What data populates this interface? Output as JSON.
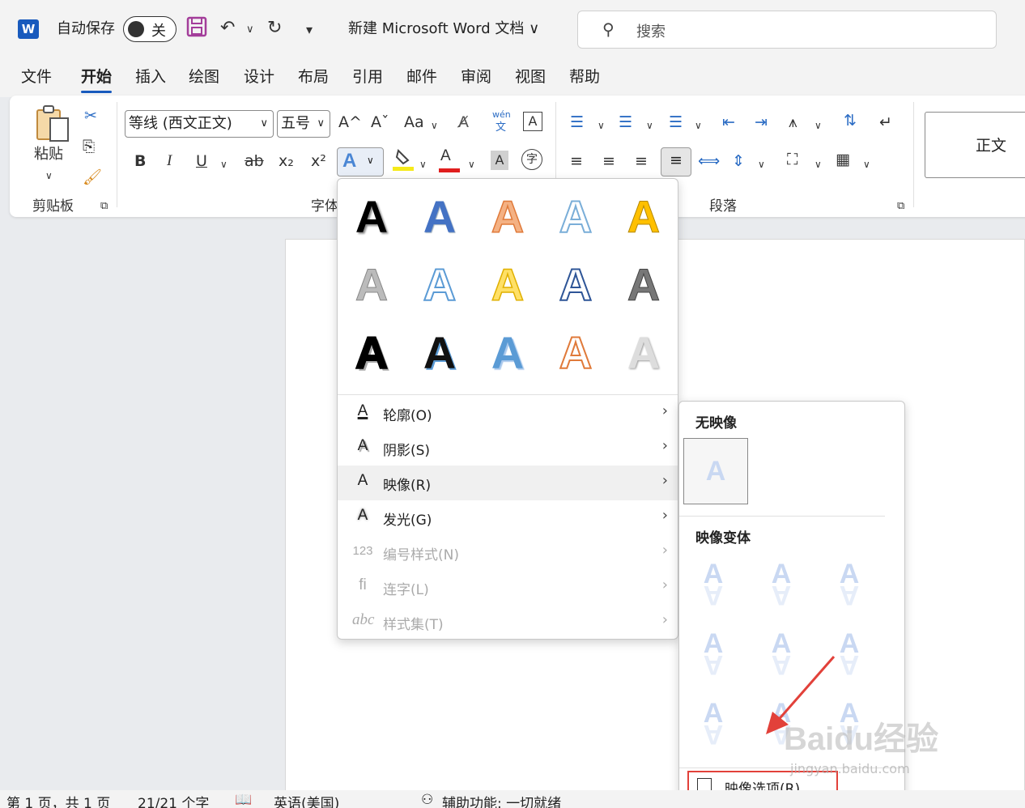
{
  "titlebar": {
    "logo": "W",
    "autosave_label": "自动保存",
    "autosave_state": "关",
    "doc_title": "新建 Microsoft Word 文档 ∨",
    "search_placeholder": "搜索"
  },
  "tabs": [
    "文件",
    "开始",
    "插入",
    "绘图",
    "设计",
    "布局",
    "引用",
    "邮件",
    "审阅",
    "视图",
    "帮助"
  ],
  "active_tab": "开始",
  "ribbon": {
    "paste_label": "粘贴",
    "clipboard_group": "剪贴板",
    "font_group": "字体",
    "paragraph_group": "段落",
    "font_name": "等线 (西文正文)",
    "font_size": "五号",
    "style_normal": "正文",
    "buttons": {
      "bold": "B",
      "italic": "I",
      "underline": "U",
      "strike": "ab",
      "sub": "x₂",
      "sup": "x²",
      "grow": "A^",
      "shrink": "Aˇ",
      "case": "Aa",
      "phonetic_top": "wén",
      "phonetic_bottom": "文"
    }
  },
  "text_effects_menu": {
    "items": [
      {
        "label": "轮廓(O)",
        "icon": "A",
        "disabled": false
      },
      {
        "label": "阴影(S)",
        "icon": "A",
        "disabled": false
      },
      {
        "label": "映像(R)",
        "icon": "A",
        "disabled": false
      },
      {
        "label": "发光(G)",
        "icon": "A",
        "disabled": false
      },
      {
        "label": "编号样式(N)",
        "icon": "123",
        "disabled": true
      },
      {
        "label": "连字(L)",
        "icon": "fi",
        "disabled": true
      },
      {
        "label": "样式集(T)",
        "icon": "abc",
        "disabled": true
      }
    ]
  },
  "reflection_submenu": {
    "no_reflection_heading": "无映像",
    "variants_heading": "映像变体",
    "options_label": "映像选项(R)..."
  },
  "statusbar": {
    "page": "第 1 页，共 1 页",
    "words": "21/21 个字",
    "language": "英语(美国)",
    "accessibility": "辅助功能: 一切就绪"
  },
  "watermark": {
    "logo": "Baidu经验",
    "url": "jingyan.baidu.com"
  },
  "colors": {
    "word_blue": "#185abd",
    "highlight_red": "#e2413a"
  }
}
